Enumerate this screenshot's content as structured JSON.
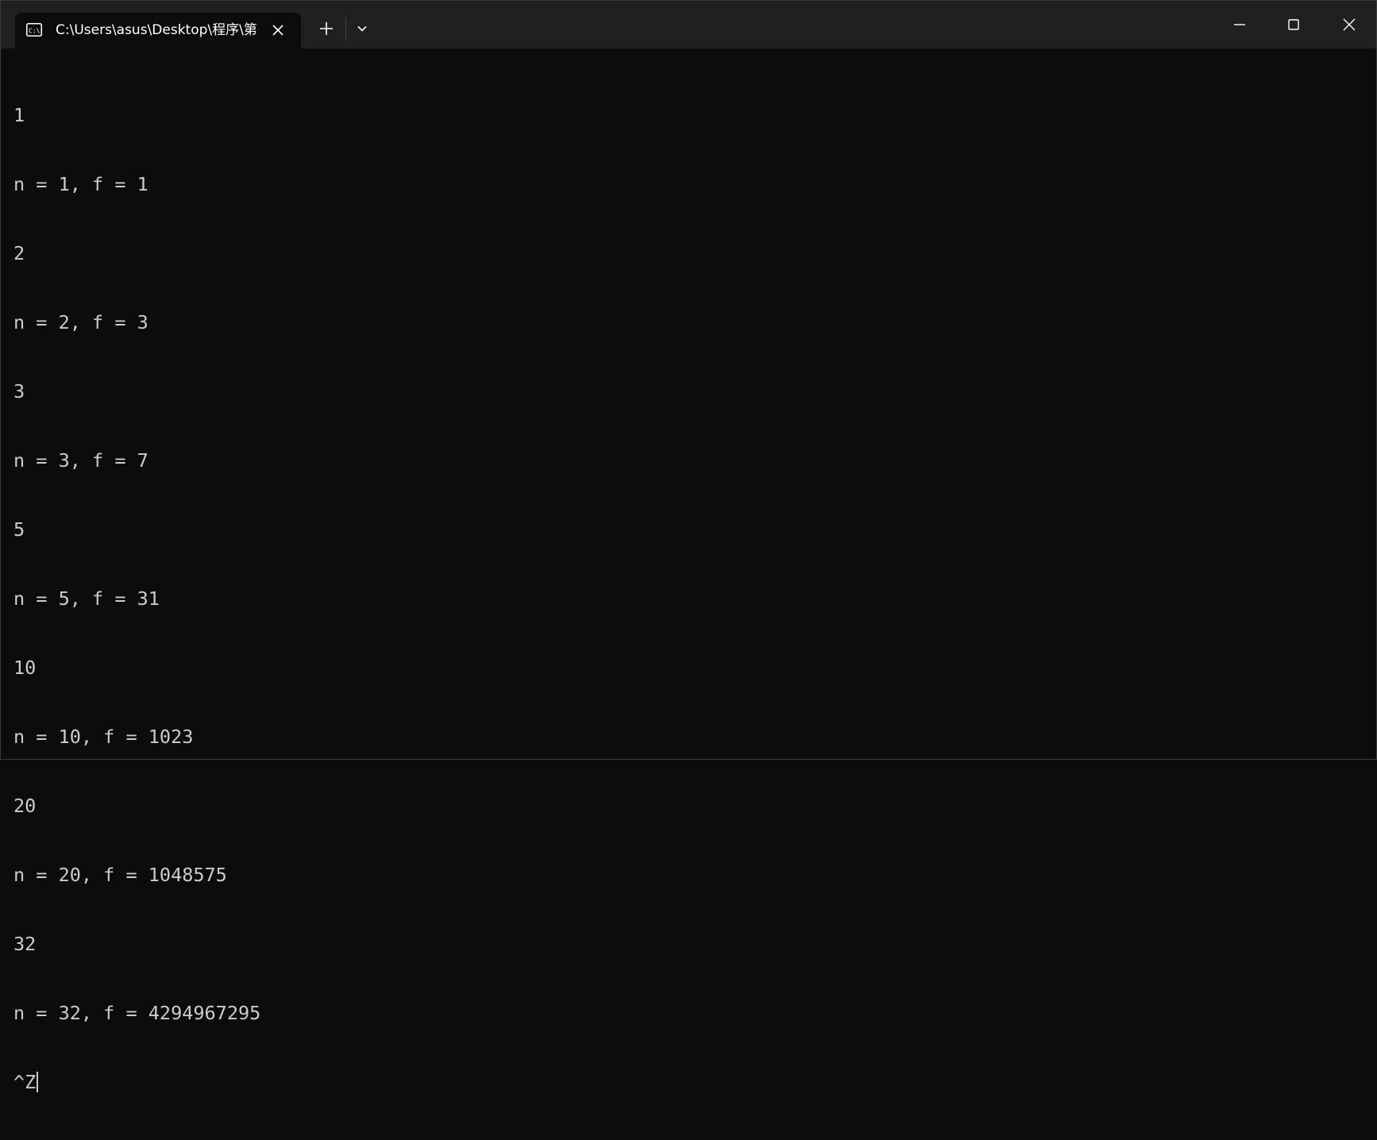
{
  "tab": {
    "title": "C:\\Users\\asus\\Desktop\\程序\\第",
    "icon": "cmd-icon"
  },
  "titlebar_icons": {
    "close_tab": "close-icon",
    "new_tab": "plus-icon",
    "dropdown": "chevron-down-icon",
    "minimize": "minimize-icon",
    "maximize": "maximize-icon",
    "close_window": "close-icon"
  },
  "terminal": {
    "lines": [
      "1",
      "n = 1, f = 1",
      "2",
      "n = 2, f = 3",
      "3",
      "n = 3, f = 7",
      "5",
      "n = 5, f = 31",
      "10",
      "n = 10, f = 1023",
      "20",
      "n = 20, f = 1048575",
      "32",
      "n = 32, f = 4294967295",
      "^Z"
    ]
  },
  "colors": {
    "background": "#0c0c0c",
    "titlebar": "#202020",
    "text": "#cccccc"
  }
}
